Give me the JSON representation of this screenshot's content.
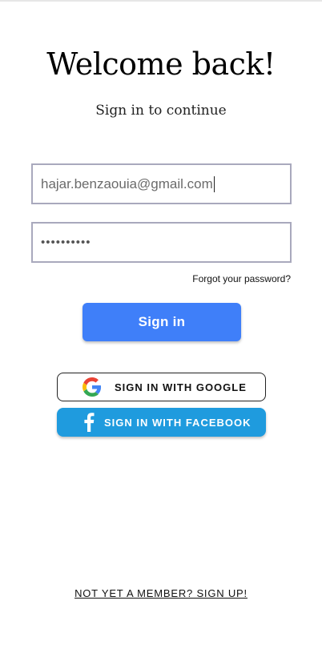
{
  "header": {
    "title": "Welcome back!",
    "subtitle": "Sign in to continue"
  },
  "form": {
    "email_value": "hajar.benzaouia@gmail.com",
    "password_masked": "••••••••••",
    "forgot_label": "Forgot your password?",
    "signin_label": "Sign in"
  },
  "social": {
    "google_label": "SIGN IN WITH GOOGLE",
    "facebook_label": "SIGN IN WITH FACEBOOK",
    "google_icon": "google-icon",
    "facebook_icon": "facebook-icon"
  },
  "footer": {
    "signup_label": "NOT YET A MEMBER? SIGN UP!"
  },
  "colors": {
    "primary": "#3f7ff9",
    "facebook": "#1f9bde",
    "field_border": "#a9a9bd"
  }
}
